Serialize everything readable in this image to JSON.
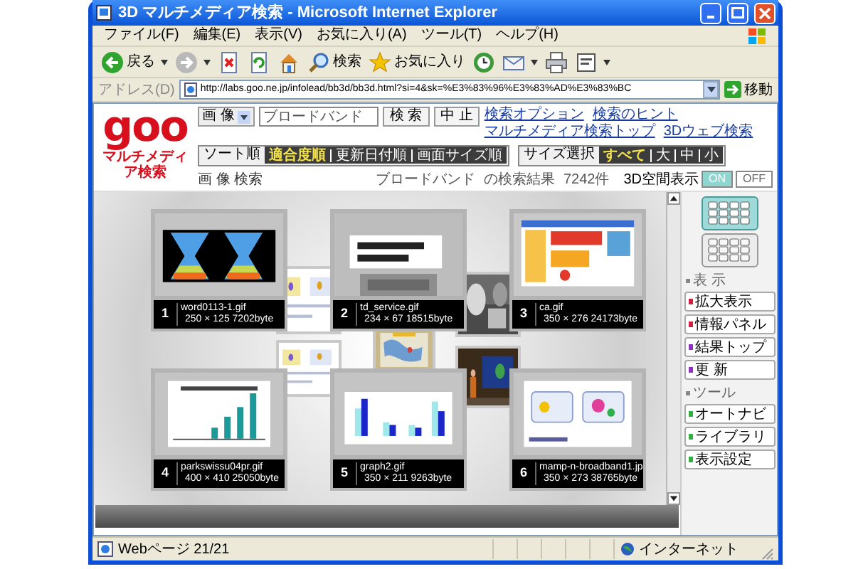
{
  "window": {
    "title": "3D マルチメディア検索 - Microsoft Internet Explorer"
  },
  "menu": [
    "ファイル(F)",
    "編集(E)",
    "表示(V)",
    "お気に入り(A)",
    "ツール(T)",
    "ヘルプ(H)"
  ],
  "toolbar": {
    "back": "戻る",
    "search": "検索",
    "favorites": "お気に入り"
  },
  "address": {
    "label": "アドレス(D)",
    "url": "http://labs.goo.ne.jp/infolead/bb3d/bb3d.html?si=4&sk=%E3%83%96%E3%83%AD%E3%83%BC",
    "go": "移動"
  },
  "goo": {
    "logo": "goo",
    "subtitle": "マルチメディア検索",
    "media_select": "画 像",
    "query": "ブロードバンド",
    "buttons": [
      "検 索",
      "中 止"
    ],
    "links": [
      "検索オプション",
      "検索のヒント",
      "マルチメディア検索トップ",
      "3Dウェブ検索"
    ],
    "sort": {
      "label": "ソート順",
      "options": [
        {
          "label": "適合度順",
          "selected": true
        },
        {
          "label": "更新日付順",
          "selected": false
        },
        {
          "label": "画面サイズ順",
          "selected": false
        }
      ]
    },
    "size": {
      "label": "サイズ選択",
      "options": [
        {
          "label": "すべて",
          "selected": true
        },
        {
          "label": "大",
          "selected": false
        },
        {
          "label": "中",
          "selected": false
        },
        {
          "label": "小",
          "selected": false
        }
      ]
    },
    "breadcrumb": "画 像 検索",
    "result": {
      "query": "ブロードバンド",
      "suffix": "の検索結果",
      "count": "7242件"
    },
    "view3d": {
      "label": "3D空間表示",
      "options": [
        {
          "label": "ON",
          "selected": true
        },
        {
          "label": "OFF",
          "selected": false
        }
      ]
    }
  },
  "results": [
    {
      "number": "1",
      "filename": "word0113-1.gif",
      "info": "250 × 125 7202byte"
    },
    {
      "number": "2",
      "filename": "td_service.gif",
      "info": "234 × 67 18515byte"
    },
    {
      "number": "3",
      "filename": "ca.gif",
      "info": "350 × 276 24173byte"
    },
    {
      "number": "4",
      "filename": "parkswissu04pr.gif",
      "info": "400 × 410 25050byte"
    },
    {
      "number": "5",
      "filename": "graph2.gif",
      "info": "350 × 211 9263byte"
    },
    {
      "number": "6",
      "filename": "mamp-n-broadband1.jp",
      "info": "350 × 273 38765byte"
    }
  ],
  "side_panel": {
    "layouts": [
      {
        "selected": true
      },
      {
        "selected": false
      }
    ],
    "sections": [
      {
        "title": "表 示",
        "buttons": [
          {
            "label": "拡大表示",
            "color": "#d02040"
          },
          {
            "label": "情報パネル",
            "color": "#d02040"
          },
          {
            "label": "結果トップ",
            "color": "#9030c0"
          },
          {
            "label": "更 新",
            "color": "#9030c0"
          }
        ]
      },
      {
        "title": "ツール",
        "buttons": [
          {
            "label": "オートナビ",
            "color": "#30b040"
          },
          {
            "label": "ライブラリ",
            "color": "#30b040"
          },
          {
            "label": "表示設定",
            "color": "#30b040"
          }
        ]
      }
    ]
  },
  "status_bar": {
    "text": "Webページ 21/21",
    "zone": "インターネット"
  }
}
